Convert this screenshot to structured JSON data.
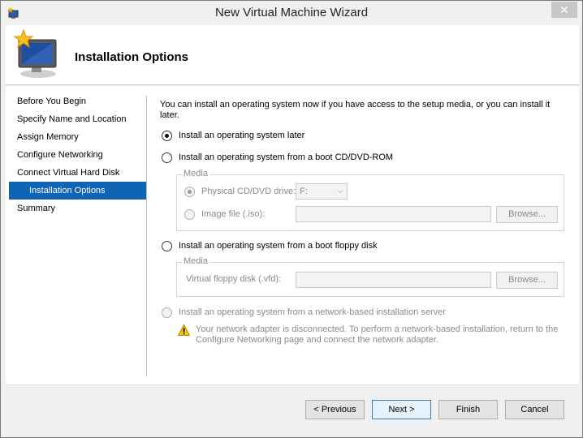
{
  "window": {
    "title": "New Virtual Machine Wizard",
    "close_glyph": "✕"
  },
  "header": {
    "title": "Installation Options",
    "icon": "monitor-with-star-icon"
  },
  "sidebar": {
    "items": [
      {
        "label": "Before You Begin",
        "selected": false
      },
      {
        "label": "Specify Name and Location",
        "selected": false
      },
      {
        "label": "Assign Memory",
        "selected": false
      },
      {
        "label": "Configure Networking",
        "selected": false
      },
      {
        "label": "Connect Virtual Hard Disk",
        "selected": false
      },
      {
        "label": "Installation Options",
        "selected": true
      },
      {
        "label": "Summary",
        "selected": false
      }
    ]
  },
  "main": {
    "intro": "You can install an operating system now if you have access to the setup media, or you can install it later.",
    "options": {
      "later": {
        "label": "Install an operating system later",
        "checked": true
      },
      "cd": {
        "label": "Install an operating system from a boot CD/DVD-ROM",
        "checked": false
      },
      "floppy": {
        "label": "Install an operating system from a boot floppy disk",
        "checked": false
      },
      "network": {
        "label": "Install an operating system from a network-based installation server",
        "checked": false,
        "disabled": true
      }
    },
    "cd_media": {
      "legend": "Media",
      "physical_label": "Physical CD/DVD drive:",
      "physical_checked": true,
      "drive_value": "F:",
      "image_label": "Image file (.iso):",
      "image_value": "",
      "browse_label": "Browse..."
    },
    "floppy_media": {
      "legend": "Media",
      "vfd_label": "Virtual floppy disk (.vfd):",
      "vfd_value": "",
      "browse_label": "Browse..."
    },
    "warning": "Your network adapter is disconnected. To perform a network-based installation, return to the Configure Networking page and connect the network adapter."
  },
  "footer": {
    "previous_label": "< Previous",
    "next_label": "Next >",
    "finish_label": "Finish",
    "cancel_label": "Cancel"
  },
  "colors": {
    "selection": "#0f64b4",
    "disabled_text": "#8a8a8a",
    "warning_yellow": "#f5c400"
  }
}
